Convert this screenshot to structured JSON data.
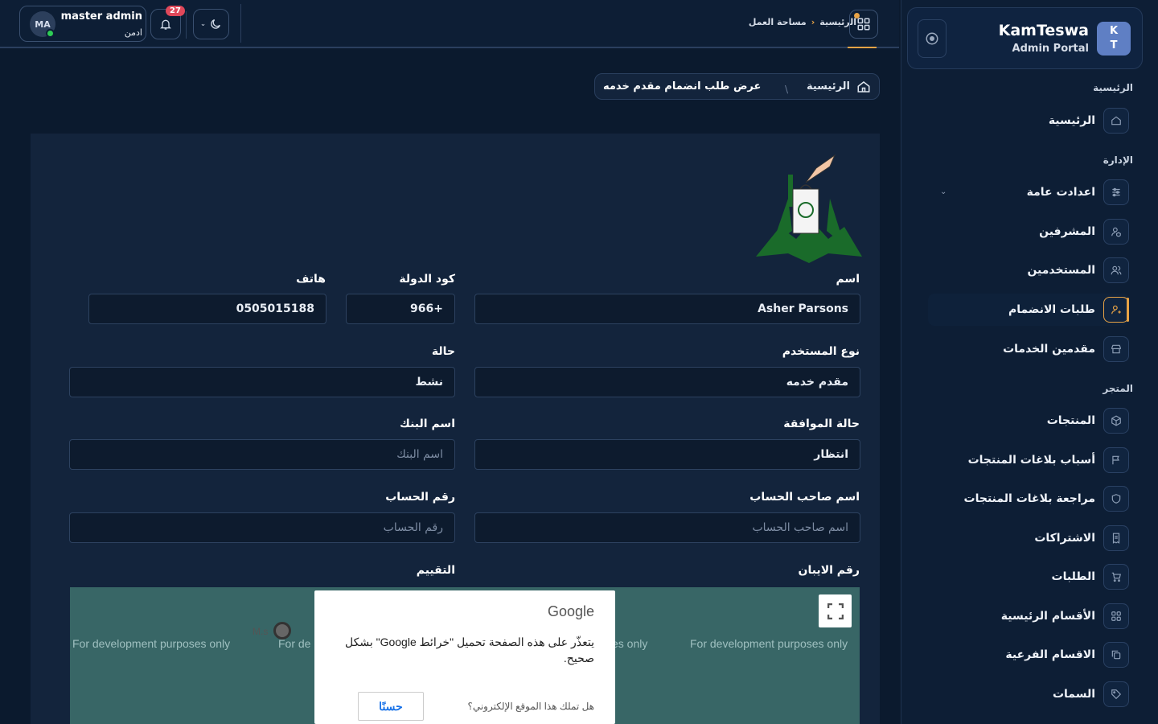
{
  "brand": {
    "logo": "K\nT",
    "logo_top": "K",
    "logo_bottom": "T",
    "name": "KamTeswa",
    "subtitle": "Admin Portal"
  },
  "sidebar": {
    "sections": [
      {
        "title": "الرئيسية"
      },
      {
        "title": "الإدارة"
      },
      {
        "title": "المتجر"
      }
    ],
    "items": [
      {
        "label": "الرئيسية",
        "icon": "home-icon"
      },
      {
        "label": "اعدادت عامة",
        "icon": "sliders-icon"
      },
      {
        "label": "المشرفين",
        "icon": "user-shield-icon"
      },
      {
        "label": "المستخدمين",
        "icon": "users-icon"
      },
      {
        "label": "طلبات الانضمام",
        "icon": "user-plus-icon",
        "active": true
      },
      {
        "label": "مقدمين الخدمات",
        "icon": "store-icon"
      },
      {
        "label": "المنتجات",
        "icon": "box-icon"
      },
      {
        "label": "أسباب بلاغات المنتجات",
        "icon": "flag-icon"
      },
      {
        "label": "مراجعة بلاغات المنتجات",
        "icon": "shield-icon"
      },
      {
        "label": "الاشتراكات",
        "icon": "receipt-icon"
      },
      {
        "label": "الطلبات",
        "icon": "cart-icon"
      },
      {
        "label": "الأقسام الرئيسية",
        "icon": "grid-icon"
      },
      {
        "label": "الاقسام الفرعية",
        "icon": "copy-icon"
      },
      {
        "label": "السمات",
        "icon": "tag-icon"
      }
    ]
  },
  "topbar": {
    "user_initials": "MA",
    "user_name": "master admin",
    "user_role": "ادمن",
    "notification_count": "27",
    "breadcrumb_home": "الرئيسية",
    "breadcrumb_sep": "›",
    "breadcrumb_current": "مساحة العمل"
  },
  "page": {
    "breadcrumb_home": "الرئيسية",
    "breadcrumb_current": "عرض طلب انضمام مقدم خدمه"
  },
  "form": {
    "name_label": "اسم",
    "name_value": "Asher Parsons",
    "country_code_label": "كود الدولة",
    "country_code_value": "966+",
    "phone_label": "هاتف",
    "phone_value": "0505015188",
    "user_type_label": "نوع المستخدم",
    "user_type_value": "مقدم خدمه",
    "status_label": "حالة",
    "status_value": "نشط",
    "approval_label": "حالة الموافقة",
    "approval_value": "انتظار",
    "bank_label": "اسم البنك",
    "bank_placeholder": "اسم البنك",
    "holder_label": "اسم صاحب الحساب",
    "holder_placeholder": "اسم صاحب الحساب",
    "account_label": "رقم الحساب",
    "account_placeholder": "رقم الحساب",
    "iban_label": "رقم الايبان",
    "rating_label": "التقييم"
  },
  "map": {
    "dev_text": "For development purposes only",
    "dev_text_partial_1": "For de",
    "dev_text_partial_2": "es only",
    "pin_label": "M.s",
    "dialog_brand": "Google",
    "dialog_message": "يتعذّر على هذه الصفحة تحميل \"خرائط Google\" بشكل صحيح.",
    "dialog_question": "هل تملك هذا الموقع الإلكتروني؟",
    "dialog_ok": "حسنًا"
  },
  "colors": {
    "accent": "#e8a346",
    "background": "#0b1a2e",
    "card": "#13243c",
    "badge": "#e0485a",
    "map": "#386666"
  }
}
